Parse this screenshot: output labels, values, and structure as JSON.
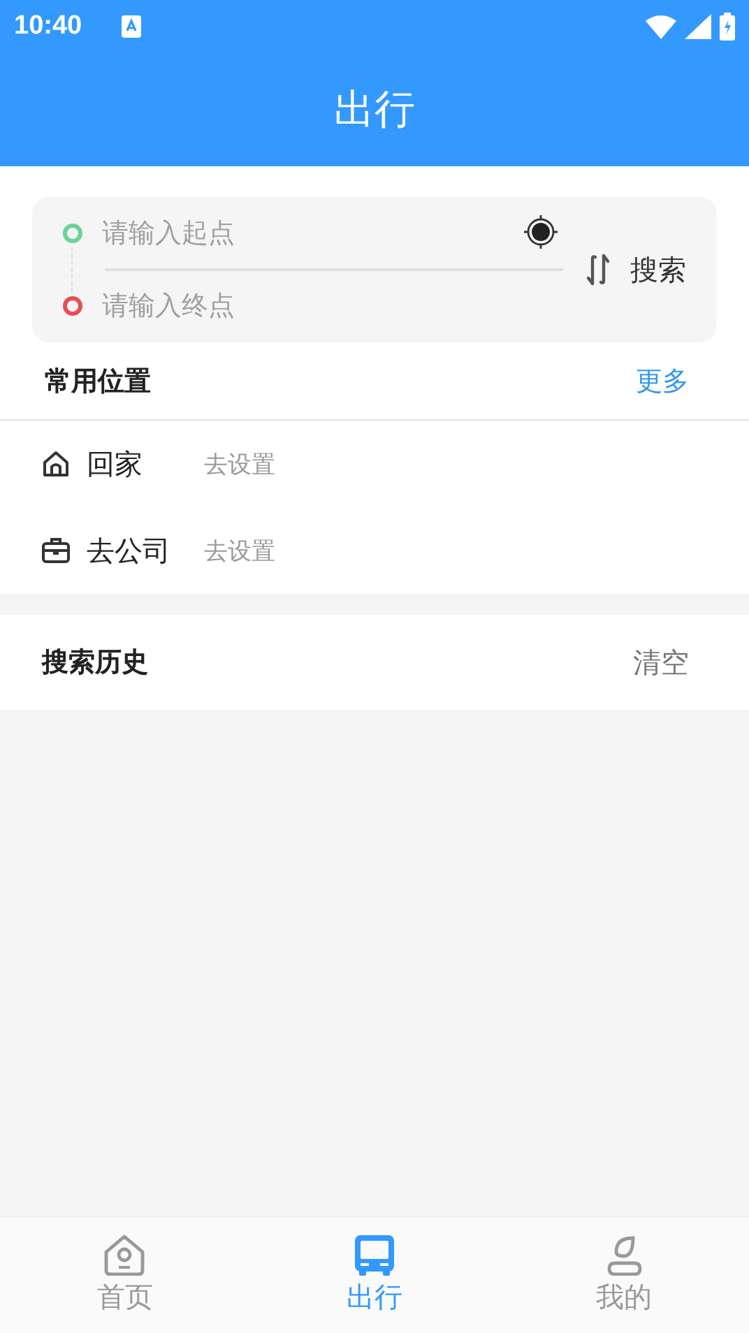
{
  "status_bar": {
    "time": "10:40"
  },
  "header": {
    "title": "出行"
  },
  "route": {
    "start_placeholder": "请输入起点",
    "end_placeholder": "请输入终点",
    "search": "搜索"
  },
  "frequent": {
    "title": "常用位置",
    "more": "更多",
    "places": [
      {
        "kind": "home",
        "name": "回家",
        "action": "去设置"
      },
      {
        "kind": "work",
        "name": "去公司",
        "action": "去设置"
      }
    ]
  },
  "history": {
    "title": "搜索历史",
    "clear": "清空"
  },
  "tabs": [
    {
      "kind": "home",
      "label": "首页",
      "selected": false
    },
    {
      "kind": "bus",
      "label": "出行",
      "selected": true
    },
    {
      "kind": "person",
      "label": "我的",
      "selected": false
    }
  ]
}
